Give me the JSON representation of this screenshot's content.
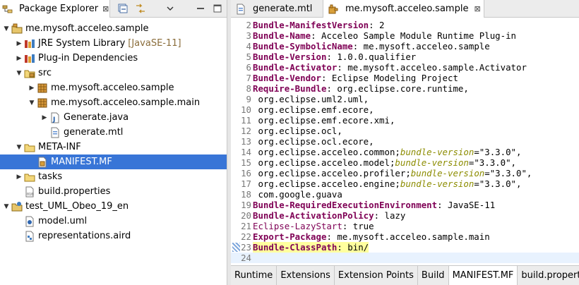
{
  "explorer": {
    "title": "Package Explorer",
    "close_symbol": "⊠",
    "tree": [
      {
        "indent": 0,
        "twisty": "expanded",
        "icon": "project-icon",
        "label": "me.mysoft.acceleo.sample"
      },
      {
        "indent": 1,
        "twisty": "collapsed",
        "icon": "library-icon",
        "label": "JRE System Library",
        "decoration": "[JavaSE-11]"
      },
      {
        "indent": 1,
        "twisty": "collapsed",
        "icon": "library-icon",
        "label": "Plug-in Dependencies"
      },
      {
        "indent": 1,
        "twisty": "expanded",
        "icon": "source-folder-icon",
        "label": "src"
      },
      {
        "indent": 2,
        "twisty": "collapsed",
        "icon": "package-icon",
        "label": "me.mysoft.acceleo.sample"
      },
      {
        "indent": 2,
        "twisty": "expanded",
        "icon": "package-icon",
        "label": "me.mysoft.acceleo.sample.main"
      },
      {
        "indent": 3,
        "twisty": "collapsed",
        "icon": "java-file-icon",
        "label": "Generate.java"
      },
      {
        "indent": 3,
        "twisty": "none",
        "icon": "mtl-file-icon",
        "label": "generate.mtl"
      },
      {
        "indent": 1,
        "twisty": "expanded",
        "icon": "folder-icon",
        "label": "META-INF"
      },
      {
        "indent": 2,
        "twisty": "none",
        "icon": "manifest-file-icon",
        "label": "MANIFEST.MF",
        "selected": true
      },
      {
        "indent": 1,
        "twisty": "collapsed",
        "icon": "folder-icon",
        "label": "tasks"
      },
      {
        "indent": 1,
        "twisty": "none",
        "icon": "properties-file-icon",
        "label": "build.properties"
      },
      {
        "indent": 0,
        "twisty": "expanded",
        "icon": "modeling-project-icon",
        "label": "test_UML_Obeo_19_en"
      },
      {
        "indent": 1,
        "twisty": "none",
        "icon": "uml-file-icon",
        "label": "model.uml"
      },
      {
        "indent": 1,
        "twisty": "none",
        "icon": "aird-file-icon",
        "label": "representations.aird"
      }
    ]
  },
  "editor": {
    "tabs": [
      {
        "label": "generate.mtl",
        "icon": "mtl-file-icon",
        "active": false
      },
      {
        "label": "me.mysoft.acceleo.sample",
        "icon": "plugin-manifest-icon",
        "active": true,
        "close_symbol": "⊠"
      }
    ],
    "lines": [
      {
        "n": "2",
        "parts": [
          {
            "t": "Bundle-ManifestVersion",
            "s": "key"
          },
          {
            "t": ": 2",
            "s": "str"
          }
        ]
      },
      {
        "n": "3",
        "parts": [
          {
            "t": "Bundle-Name",
            "s": "key"
          },
          {
            "t": ": Acceleo Sample Module Runtime Plug-in",
            "s": "str"
          }
        ]
      },
      {
        "n": "4",
        "parts": [
          {
            "t": "Bundle-SymbolicName",
            "s": "key"
          },
          {
            "t": ": me.mysoft.acceleo.sample",
            "s": "str"
          }
        ]
      },
      {
        "n": "5",
        "parts": [
          {
            "t": "Bundle-Version",
            "s": "key"
          },
          {
            "t": ": 1.0.0.qualifier",
            "s": "str"
          }
        ]
      },
      {
        "n": "6",
        "parts": [
          {
            "t": "Bundle-Activator",
            "s": "key"
          },
          {
            "t": ": me.mysoft.acceleo.sample.Activator",
            "s": "str"
          }
        ]
      },
      {
        "n": "7",
        "parts": [
          {
            "t": "Bundle-Vendor",
            "s": "key"
          },
          {
            "t": ": Eclipse Modeling Project",
            "s": "str"
          }
        ]
      },
      {
        "n": "8",
        "parts": [
          {
            "t": "Require-Bundle",
            "s": "key"
          },
          {
            "t": ": org.eclipse.core.runtime,",
            "s": "str"
          }
        ]
      },
      {
        "n": "9",
        "parts": [
          {
            "t": " org.eclipse.uml2.uml,",
            "s": "str"
          }
        ]
      },
      {
        "n": "10",
        "parts": [
          {
            "t": " org.eclipse.emf.ecore,",
            "s": "str"
          }
        ]
      },
      {
        "n": "11",
        "parts": [
          {
            "t": " org.eclipse.emf.ecore.xmi,",
            "s": "str"
          }
        ]
      },
      {
        "n": "12",
        "parts": [
          {
            "t": " org.eclipse.ocl,",
            "s": "str"
          }
        ]
      },
      {
        "n": "13",
        "parts": [
          {
            "t": " org.eclipse.ocl.ecore,",
            "s": "str"
          }
        ]
      },
      {
        "n": "14",
        "parts": [
          {
            "t": " org.eclipse.acceleo.common;",
            "s": "str"
          },
          {
            "t": "bundle-version",
            "s": "attr"
          },
          {
            "t": "=\"3.3.0\",",
            "s": "str"
          }
        ]
      },
      {
        "n": "15",
        "parts": [
          {
            "t": " org.eclipse.acceleo.model;",
            "s": "str"
          },
          {
            "t": "bundle-version",
            "s": "attr"
          },
          {
            "t": "=\"3.3.0\",",
            "s": "str"
          }
        ]
      },
      {
        "n": "16",
        "parts": [
          {
            "t": " org.eclipse.acceleo.profiler;",
            "s": "str"
          },
          {
            "t": "bundle-version",
            "s": "attr"
          },
          {
            "t": "=\"3.3.0\",",
            "s": "str"
          }
        ]
      },
      {
        "n": "17",
        "parts": [
          {
            "t": " org.eclipse.acceleo.engine;",
            "s": "str"
          },
          {
            "t": "bundle-version",
            "s": "attr"
          },
          {
            "t": "=\"3.3.0\",",
            "s": "str"
          }
        ]
      },
      {
        "n": "18",
        "parts": [
          {
            "t": " com.google.guava",
            "s": "str"
          }
        ]
      },
      {
        "n": "19",
        "parts": [
          {
            "t": "Bundle-RequiredExecutionEnvironment",
            "s": "key"
          },
          {
            "t": ": JavaSE-11",
            "s": "str"
          }
        ]
      },
      {
        "n": "20",
        "parts": [
          {
            "t": "Bundle-ActivationPolicy",
            "s": "key"
          },
          {
            "t": ": lazy",
            "s": "str"
          }
        ]
      },
      {
        "n": "21",
        "parts": [
          {
            "t": "Eclipse-LazyStart",
            "s": "key-plain"
          },
          {
            "t": ": true",
            "s": "str"
          }
        ]
      },
      {
        "n": "22",
        "parts": [
          {
            "t": "Export-Package",
            "s": "key"
          },
          {
            "t": ": me.mysoft.acceleo.sample.main",
            "s": "str"
          }
        ]
      },
      {
        "n": "23",
        "marker": true,
        "parts": [
          {
            "t": "Bundle-ClassPath",
            "s": "key mark-yellow"
          },
          {
            "t": ": bin/",
            "s": "str mark-yellow"
          }
        ]
      },
      {
        "n": "24",
        "current": true,
        "parts": []
      }
    ],
    "bottom_tabs": [
      {
        "label": "Runtime",
        "active": false
      },
      {
        "label": "Extensions",
        "active": false
      },
      {
        "label": "Extension Points",
        "active": false
      },
      {
        "label": "Build",
        "active": false
      },
      {
        "label": "MANIFEST.MF",
        "active": true
      },
      {
        "label": "build.propertie",
        "active": false
      }
    ]
  },
  "colors": {
    "selection": "#3875d7",
    "keyword": "#7f0055",
    "attribute": "#8c8c00",
    "current_line": "#e8f2fe",
    "highlight": "#ffff9e"
  }
}
